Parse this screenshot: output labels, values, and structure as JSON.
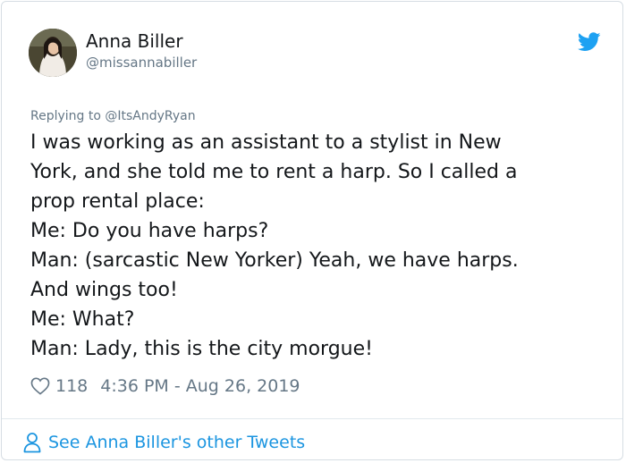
{
  "author": {
    "name": "Anna Biller",
    "handle": "@missannabiller"
  },
  "reply": {
    "prefix": "Replying to ",
    "mention": "@ItsAndyRyan"
  },
  "tweet": {
    "lines": [
      "I was working as an assistant to a stylist in New",
      "York, and she told me to rent a harp. So I called a",
      "prop rental place:",
      "Me: Do you have harps?",
      "Man: (sarcastic New Yorker) Yeah, we have harps.",
      "And wings too!",
      "Me: What?",
      "Man: Lady, this is the city morgue!"
    ]
  },
  "meta": {
    "likes": "118",
    "timestamp": "4:36 PM - Aug 26, 2019"
  },
  "footer": {
    "link_label": "See Anna Biller's other Tweets"
  },
  "icons": {
    "brand": "twitter-bird-icon",
    "like": "heart-icon",
    "profile": "person-icon"
  },
  "colors": {
    "brand": "#1da1f2",
    "link": "#1b95e0",
    "muted": "#657786",
    "text": "#14171a"
  }
}
